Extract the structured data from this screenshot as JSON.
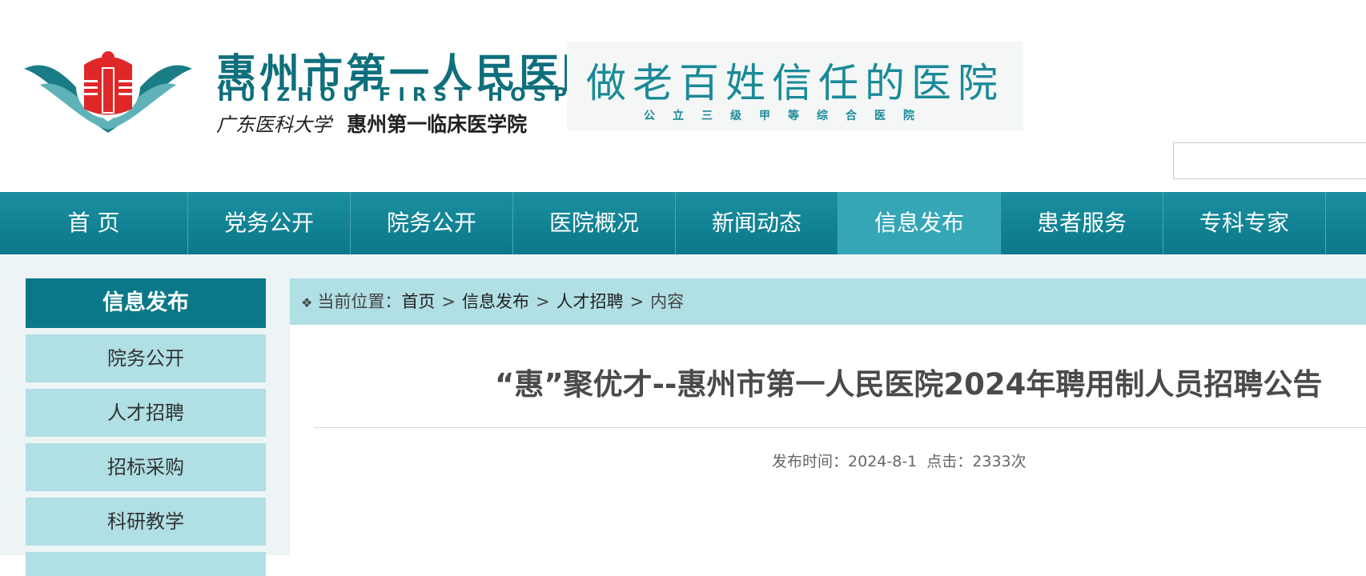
{
  "header": {
    "hospital_name_cn": "惠州市第一人民医院",
    "hospital_name_en": "HUIZHOU FIRST HOSPITAL",
    "university": "广东医科大学",
    "college": "惠州第一临床医学院",
    "slogan": "做老百姓信任的医院",
    "slogan_sub": "公立三级甲等综合医院",
    "search_placeholder": ""
  },
  "nav": {
    "items": [
      {
        "label": "首 页"
      },
      {
        "label": "党务公开"
      },
      {
        "label": "院务公开"
      },
      {
        "label": "医院概况"
      },
      {
        "label": "新闻动态"
      },
      {
        "label": "信息发布",
        "active": true
      },
      {
        "label": "患者服务"
      },
      {
        "label": "专科专家"
      }
    ]
  },
  "sidebar": {
    "title": "信息发布",
    "items": [
      {
        "label": "院务公开"
      },
      {
        "label": "人才招聘"
      },
      {
        "label": "招标采购"
      },
      {
        "label": "科研教学"
      }
    ]
  },
  "breadcrumb": {
    "prefix": "当前位置：",
    "items": [
      "首页",
      "信息发布",
      "人才招聘",
      "内容"
    ],
    "separator": ">"
  },
  "article": {
    "title": "“惠”聚优才--惠州市第一人民医院2024年聘用制人员招聘公告",
    "publish_label": "发布时间：",
    "publish_date": "2024-8-1",
    "clicks_label": "点击：",
    "clicks": "2333次"
  },
  "colors": {
    "brand_teal": "#0a7889",
    "light_teal": "#b0dfe5",
    "nav_active": "#35a6b5"
  }
}
